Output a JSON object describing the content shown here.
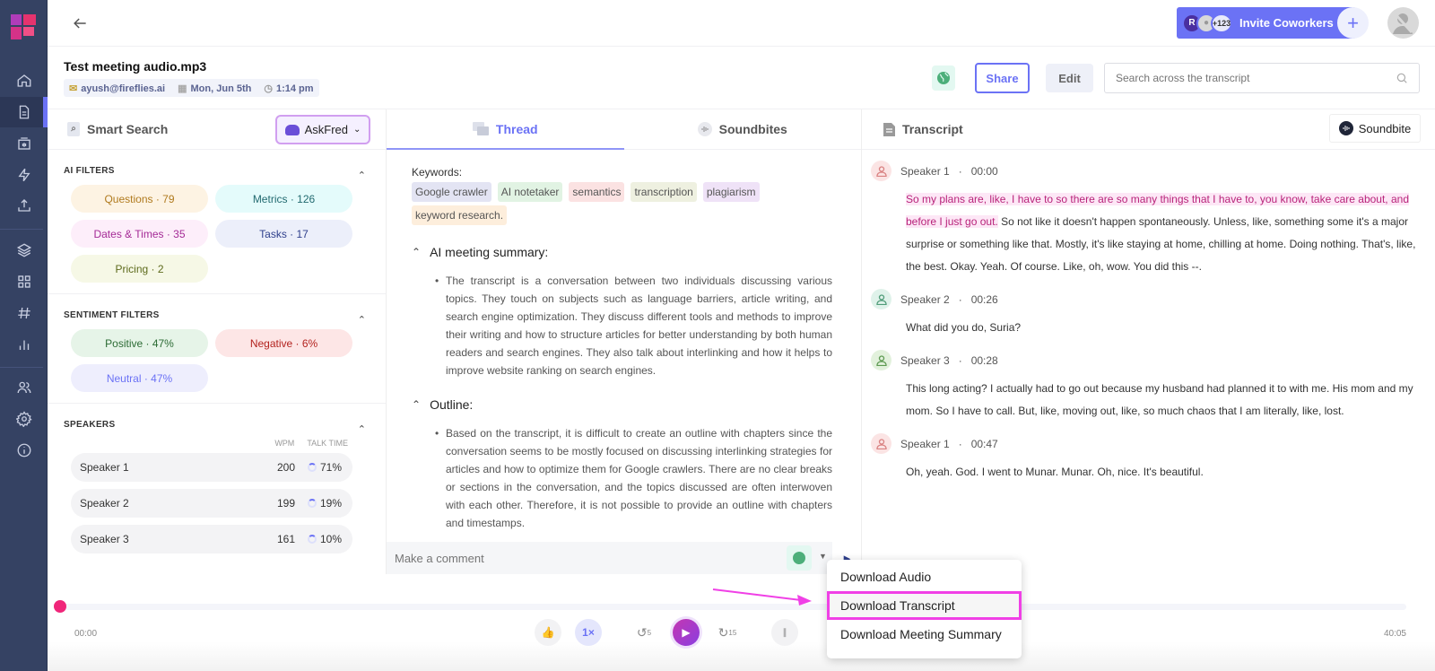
{
  "app": {
    "invite_label": "Invite Coworkers",
    "avatar_initial": "R",
    "avatar_count": "+123",
    "back_icon": "arrow-left-icon"
  },
  "sidebar": {
    "items": [
      {
        "name": "home",
        "icon": "home-icon"
      },
      {
        "name": "notebook",
        "icon": "document-icon",
        "active": true
      },
      {
        "name": "meetings",
        "icon": "calendar-audio-icon"
      },
      {
        "name": "integrations",
        "icon": "lightning-icon"
      },
      {
        "name": "upload",
        "icon": "upload-icon"
      },
      {
        "name": "topics",
        "icon": "layers-icon"
      },
      {
        "name": "apps",
        "icon": "grid-icon"
      },
      {
        "name": "channels",
        "icon": "hash-icon"
      },
      {
        "name": "analytics",
        "icon": "bar-chart-icon"
      },
      {
        "name": "team",
        "icon": "users-icon"
      },
      {
        "name": "settings",
        "icon": "gear-icon"
      },
      {
        "name": "info",
        "icon": "info-icon"
      }
    ]
  },
  "meeting": {
    "title": "Test meeting audio.mp3",
    "owner": "ayush@fireflies.ai",
    "date": "Mon, Jun 5th",
    "time": "1:14 pm"
  },
  "toolbar": {
    "share_label": "Share",
    "edit_label": "Edit",
    "search_placeholder": "Search across the transcript"
  },
  "smart_search": {
    "title": "Smart Search",
    "askfred_label": "AskFred",
    "ai_filters_title": "AI FILTERS",
    "ai_filters": [
      {
        "label": "Questions · 79",
        "bg": "#fdf3e3",
        "fg": "#b07a1e"
      },
      {
        "label": "Metrics · 126",
        "bg": "#e4fbfb",
        "fg": "#226a70"
      },
      {
        "label": "Dates & Times · 35",
        "bg": "#fdeefa",
        "fg": "#a42a96"
      },
      {
        "label": "Tasks · 17",
        "bg": "#eceffa",
        "fg": "#2e3f8c"
      },
      {
        "label": "Pricing · 2",
        "bg": "#f6f8e6",
        "fg": "#5d6a1c"
      }
    ],
    "sentiment_title": "SENTIMENT FILTERS",
    "sentiment_filters": [
      {
        "label": "Positive · 47%",
        "bg": "#e6f4e8",
        "fg": "#2c6b34"
      },
      {
        "label": "Negative · 6%",
        "bg": "#fde6e6",
        "fg": "#b3231f"
      },
      {
        "label": "Neutral · 47%",
        "bg": "#eeeefd",
        "fg": "#6b72f5"
      }
    ],
    "speakers_title": "SPEAKERS",
    "wpm_label": "WPM",
    "talk_time_label": "TALK TIME",
    "speakers": [
      {
        "name": "Speaker 1",
        "wpm": "200",
        "talk": "71%",
        "talk_fraction": 0.71
      },
      {
        "name": "Speaker 2",
        "wpm": "199",
        "talk": "19%",
        "talk_fraction": 0.19
      },
      {
        "name": "Speaker 3",
        "wpm": "161",
        "talk": "10%",
        "talk_fraction": 0.1
      }
    ]
  },
  "thread": {
    "tabs": [
      {
        "label": "Thread",
        "active": true
      },
      {
        "label": "Soundbites",
        "active": false
      }
    ],
    "keywords_label": "Keywords:",
    "keywords": [
      {
        "text": "Google crawler",
        "bg": "#e3e4f3"
      },
      {
        "text": "AI notetaker",
        "bg": "#e1f3e3"
      },
      {
        "text": "semantics",
        "bg": "#fbe2e2"
      },
      {
        "text": "transcription",
        "bg": "#eef0e0"
      },
      {
        "text": "plagiarism",
        "bg": "#efe2f7"
      },
      {
        "text": "keyword research.",
        "bg": "#fdeedc"
      }
    ],
    "summary_title": "AI meeting summary:",
    "summary_text": "The transcript is a conversation between two individuals discussing various topics. They touch on subjects such as language barriers, article writing, and search engine optimization. They discuss different tools and methods to improve their writing and how to structure articles for better understanding by both human readers and search engines. They also talk about interlinking and how it helps to improve website ranking on search engines.",
    "outline_title": "Outline:",
    "outline_text": "Based on the transcript, it is difficult to create an outline with chapters since the conversation seems to be mostly focused on discussing interlinking strategies for articles and how to optimize them for Google crawlers. There are no clear breaks or sections in the conversation, and the topics discussed are often interwoven with each other. Therefore, it is not possible to provide an outline with chapters and timestamps.",
    "comment_placeholder": "Make a comment"
  },
  "transcript": {
    "title": "Transcript",
    "soundbite_label": "Soundbite",
    "entries": [
      {
        "speaker": "Speaker 1",
        "time": "00:00",
        "color": "#fbe4e4",
        "iconColor": "#d98080",
        "highlight": "So my plans are, like, I have to so there are so many things that I have to, you know, take care about, and before I just go out.",
        "text": " So not like it doesn't happen spontaneously. Unless, like, something some it's a major surprise or something like that. Mostly, it's like staying at home, chilling at home. Doing nothing. That's, like, the best. Okay. Yeah. Of course. Like, oh, wow. You did this --."
      },
      {
        "speaker": "Speaker 2",
        "time": "00:26",
        "color": "#dff2ea",
        "iconColor": "#4f9c78",
        "highlight": "",
        "text": "What did you do, Suria?"
      },
      {
        "speaker": "Speaker 3",
        "time": "00:28",
        "color": "#e2f1dc",
        "iconColor": "#5d9a52",
        "highlight": "",
        "text": "This long acting? I actually had to go out because my husband had planned it to with me. His mom and my mom. So I have to call. But, like, moving out, like, so much chaos that I am literally, like, lost."
      },
      {
        "speaker": "Speaker 1",
        "time": "00:47",
        "color": "#fbe4e4",
        "iconColor": "#d98080",
        "highlight": "",
        "text": "Oh, yeah. God. I went to Munar. Munar. Oh, nice. It's beautiful."
      }
    ]
  },
  "player": {
    "current_time": "00:00",
    "total_time": "40:05",
    "progress": 0,
    "speed_label": "1×",
    "rewind_label": "5",
    "forward_label": "15"
  },
  "download_menu": {
    "items": [
      {
        "label": "Download Audio",
        "selected": false
      },
      {
        "label": "Download Transcript",
        "selected": true
      },
      {
        "label": "Download Meeting Summary",
        "selected": false
      }
    ]
  },
  "colors": {
    "accent": "#6b72f5",
    "sidebar": "#354263",
    "annotation": "#f040e6"
  }
}
